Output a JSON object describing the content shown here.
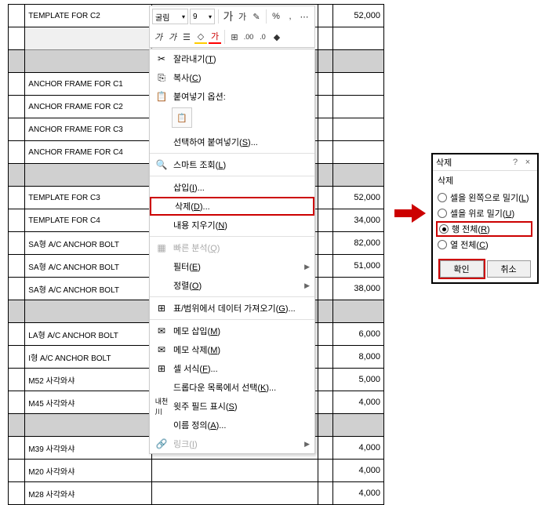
{
  "toolbar": {
    "font": "굴림",
    "size": "9",
    "bold": "가",
    "italic": "가",
    "percent": "%",
    "comma": ","
  },
  "table": {
    "rows": [
      {
        "label": "TEMPLATE FOR C2",
        "value": "52,000",
        "grey": false
      },
      {
        "label": "",
        "value": "",
        "grey": false,
        "selected": true
      },
      {
        "label": "",
        "value": "",
        "grey": true
      },
      {
        "label": "ANCHOR FRAME FOR C1",
        "value": "",
        "grey": false
      },
      {
        "label": "ANCHOR FRAME FOR C2",
        "value": "",
        "grey": false
      },
      {
        "label": "ANCHOR FRAME FOR C3",
        "value": "",
        "grey": false
      },
      {
        "label": "ANCHOR FRAME FOR C4",
        "value": "",
        "grey": false
      },
      {
        "label": "",
        "value": "",
        "grey": true
      },
      {
        "label": "TEMPLATE FOR C3",
        "value": "52,000",
        "grey": false
      },
      {
        "label": "TEMPLATE FOR C4",
        "value": "34,000",
        "grey": false
      },
      {
        "label": "SA형 A/C ANCHOR BOLT",
        "value": "82,000",
        "grey": false
      },
      {
        "label": "SA형 A/C ANCHOR BOLT",
        "value": "51,000",
        "grey": false
      },
      {
        "label": "SA형 A/C ANCHOR BOLT",
        "value": "38,000",
        "grey": false
      },
      {
        "label": "",
        "value": "",
        "grey": true
      },
      {
        "label": "LA형 A/C ANCHOR BOLT",
        "value": "6,000",
        "grey": false
      },
      {
        "label": "I형 A/C ANCHOR BOLT",
        "value": "8,000",
        "grey": false
      },
      {
        "label": "M52 사각와샤",
        "value": "5,000",
        "grey": false
      },
      {
        "label": "M45 사각와샤",
        "value": "4,000",
        "grey": false
      },
      {
        "label": "",
        "value": "",
        "grey": true
      },
      {
        "label": "M39 사각와샤",
        "value": "4,000",
        "grey": false
      },
      {
        "label": "M20 사각와샤",
        "value": "4,000",
        "grey": false
      },
      {
        "label": "M28 사각와샤",
        "value": "4,000",
        "grey": false
      }
    ]
  },
  "menu": {
    "cut": "잘라내기",
    "cut_key": "T",
    "copy": "복사",
    "copy_key": "C",
    "paste_options": "붙여넣기 옵션:",
    "paste_special": "선택하여 붙여넣기",
    "paste_special_key": "S",
    "smart_lookup": "스마트 조회",
    "smart_lookup_key": "L",
    "insert": "삽입",
    "insert_key": "I",
    "delete": "삭제",
    "delete_key": "D",
    "clear": "내용 지우기",
    "clear_key": "N",
    "quick_analysis": "빠른 분석",
    "quick_analysis_key": "Q",
    "filter": "필터",
    "filter_key": "E",
    "sort": "정렬",
    "sort_key": "O",
    "get_data": "표/범위에서 데이터 가져오기",
    "get_data_key": "G",
    "insert_memo": "메모 삽입",
    "insert_memo_key": "M",
    "delete_memo": "메모 삭제",
    "delete_memo_key": "M",
    "format_cells": "셀 서식",
    "format_cells_key": "F",
    "dropdown_select": "드롭다운 목록에서 선택",
    "dropdown_select_key": "K",
    "phonetic": "윗주 필드 표시",
    "phonetic_key": "S",
    "define_name": "이름 정의",
    "define_name_key": "A",
    "link": "링크",
    "link_key": "I"
  },
  "dialog": {
    "title": "삭제",
    "question": "?",
    "close": "×",
    "label": "삭제",
    "opt1": "셀을 왼쪽으로 밀기",
    "opt1_key": "L",
    "opt2": "셀을 위로 밀기",
    "opt2_key": "U",
    "opt3": "행 전체",
    "opt3_key": "R",
    "opt4": "열 전체",
    "opt4_key": "C",
    "ok": "확인",
    "cancel": "취소"
  }
}
